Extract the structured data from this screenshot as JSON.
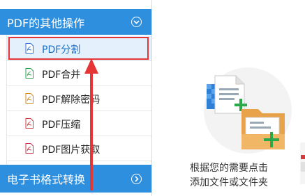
{
  "sidebar": {
    "section1": {
      "title": "PDF的其他操作",
      "icon": "chevron-circle-down-icon"
    },
    "items": [
      {
        "label": "PDF分割",
        "icon": "pdf-file-icon",
        "color": "#2f6fd0"
      },
      {
        "label": "PDF合并",
        "icon": "pdf-file-icon",
        "color": "#2aa04a"
      },
      {
        "label": "PDF解除密码",
        "icon": "pdf-file-icon",
        "color": "#d08a1a"
      },
      {
        "label": "PDF压缩",
        "icon": "pdf-file-icon",
        "color": "#d13b3b"
      },
      {
        "label": "PDF图片获取",
        "icon": "pdf-file-icon",
        "color": "#c8324a"
      }
    ],
    "section2": {
      "title": "电子书格式转换",
      "icon": "chevron-circle-right-icon"
    }
  },
  "main": {
    "hint_line1": "根据您的需要点击",
    "hint_line2": "添加文件或文件夹",
    "illustration_icon": "add-files-folder-icon"
  },
  "colors": {
    "accent": "#2f8fdf",
    "highlight": "#e53535",
    "selected_bg": "#e4f0fc"
  }
}
